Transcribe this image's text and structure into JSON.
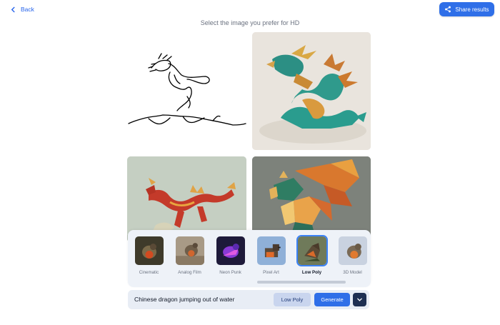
{
  "header": {
    "back_label": "Back",
    "share_label": "Share results"
  },
  "page_title": "Select the image you prefer for HD",
  "results": [
    {
      "name": "sketch-input",
      "description": "line sketch"
    },
    {
      "name": "result-1"
    },
    {
      "name": "result-2"
    },
    {
      "name": "result-3"
    }
  ],
  "styles": {
    "items": [
      {
        "label": "Cinematic",
        "selected": false
      },
      {
        "label": "Analog Film",
        "selected": false
      },
      {
        "label": "Neon Punk",
        "selected": false
      },
      {
        "label": "Pixel Art",
        "selected": false
      },
      {
        "label": "Low Poly",
        "selected": true
      },
      {
        "label": "3D Model",
        "selected": false
      }
    ]
  },
  "prompt": {
    "value": "Chinese dragon jumping out of water",
    "style_chip": "Low Poly",
    "generate_label": "Generate"
  },
  "colors": {
    "accent": "#2f6fe8",
    "dark_button": "#1e2f52",
    "panel": "#eef2f8"
  }
}
